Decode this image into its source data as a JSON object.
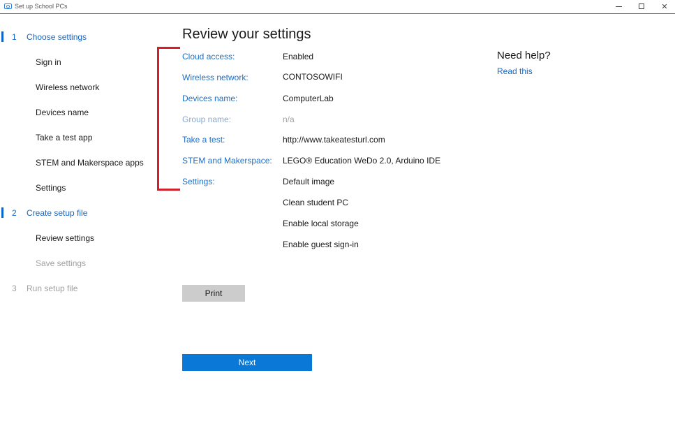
{
  "window": {
    "title": "Set up School PCs",
    "controls": {
      "minimize": "minimize",
      "maximize": "maximize",
      "close": "✕"
    }
  },
  "sidebar": {
    "steps": [
      {
        "num": "1",
        "label": "Choose settings",
        "state": "active",
        "items": [
          {
            "label": "Sign in"
          },
          {
            "label": "Wireless network"
          },
          {
            "label": "Devices name"
          },
          {
            "label": "Take a test app"
          },
          {
            "label": "STEM and Makerspace apps"
          },
          {
            "label": "Settings"
          }
        ]
      },
      {
        "num": "2",
        "label": "Create setup file",
        "state": "active",
        "items": [
          {
            "label": "Review settings",
            "state": "normal"
          },
          {
            "label": "Save settings",
            "state": "disabled"
          }
        ]
      },
      {
        "num": "3",
        "label": "Run setup file",
        "state": "disabled",
        "items": []
      }
    ]
  },
  "main": {
    "title": "Review your settings",
    "rows": [
      {
        "label": "Cloud access:",
        "value": "Enabled"
      },
      {
        "label": "Wireless network:",
        "value": "CONTOSOWIFI"
      },
      {
        "label": "Devices name:",
        "value": "ComputerLab"
      },
      {
        "label": "Group name:",
        "value": "n/a"
      },
      {
        "label": "Take a test:",
        "value": "http://www.takeatesturl.com"
      },
      {
        "label": "STEM and Makerspace:",
        "value": "LEGO® Education WeDo 2.0, Arduino IDE"
      },
      {
        "label": "Settings:",
        "value": "Default image"
      }
    ],
    "settings_extra": [
      "Clean student PC",
      "Enable local storage",
      "Enable guest sign-in"
    ],
    "print_label": "Print",
    "next_label": "Next"
  },
  "help": {
    "title": "Need help?",
    "link": "Read this"
  },
  "colors": {
    "accent": "#0a78d7",
    "link": "#1f6ec4",
    "annotation_bracket": "#d1202b",
    "disabled": "#a0a0a0"
  }
}
